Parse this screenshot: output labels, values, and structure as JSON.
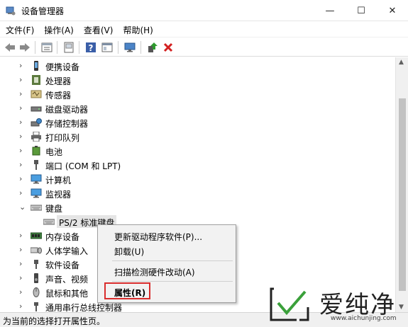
{
  "window": {
    "title": "设备管理器",
    "controls": {
      "minimize": "—",
      "maximize": "☐",
      "close": "✕"
    }
  },
  "menu": [
    "文件(F)",
    "操作(A)",
    "查看(V)",
    "帮助(H)"
  ],
  "toolbar": {
    "buttons": [
      "back-icon",
      "forward-icon",
      "properties-icon",
      "scan-icon",
      "help-icon",
      "view-icon",
      "monitor-icon",
      "update-driver-icon",
      "uninstall-icon"
    ],
    "colors": {
      "uninstall": "#d32020",
      "update": "#2e9a2e"
    }
  },
  "tree": {
    "items": [
      {
        "label": "便携设备",
        "icon": "portable-device-icon",
        "expanded": false
      },
      {
        "label": "处理器",
        "icon": "processor-icon",
        "expanded": false
      },
      {
        "label": "传感器",
        "icon": "sensor-icon",
        "expanded": false
      },
      {
        "label": "磁盘驱动器",
        "icon": "disk-drive-icon",
        "expanded": false
      },
      {
        "label": "存储控制器",
        "icon": "storage-controller-icon",
        "expanded": false
      },
      {
        "label": "打印队列",
        "icon": "printer-icon",
        "expanded": false
      },
      {
        "label": "电池",
        "icon": "battery-icon",
        "expanded": false
      },
      {
        "label": "端口 (COM 和 LPT)",
        "icon": "port-icon",
        "expanded": false
      },
      {
        "label": "计算机",
        "icon": "computer-icon",
        "expanded": false
      },
      {
        "label": "监视器",
        "icon": "monitor-icon",
        "expanded": false
      },
      {
        "label": "键盘",
        "icon": "keyboard-icon",
        "expanded": true
      },
      {
        "label": "PS/2 标准键盘",
        "icon": "keyboard-icon",
        "child": true,
        "selected": true
      },
      {
        "label": "内存设备",
        "icon": "memory-icon",
        "expanded": false
      },
      {
        "label": "人体学输入",
        "icon": "hid-icon",
        "expanded": false
      },
      {
        "label": "软件设备",
        "icon": "software-device-icon",
        "expanded": false
      },
      {
        "label": "声音、视频",
        "icon": "audio-icon",
        "expanded": false
      },
      {
        "label": "鼠标和其他",
        "icon": "mouse-icon",
        "expanded": false
      },
      {
        "label": "通用串行总线控制器",
        "icon": "usb-icon",
        "expanded": false
      }
    ]
  },
  "context_menu": {
    "items": [
      {
        "label": "更新驱动程序软件(P)..."
      },
      {
        "label": "卸载(U)"
      },
      {
        "label": "扫描检测硬件改动(A)"
      },
      {
        "label": "属性(R)",
        "bold": true,
        "highlighted": true
      }
    ],
    "highlight_color": "#d92d2d"
  },
  "status": {
    "text": "为当前的选择打开属性页。"
  },
  "watermark": {
    "text": "爱纯净",
    "url": "www.aichunjing.com"
  }
}
